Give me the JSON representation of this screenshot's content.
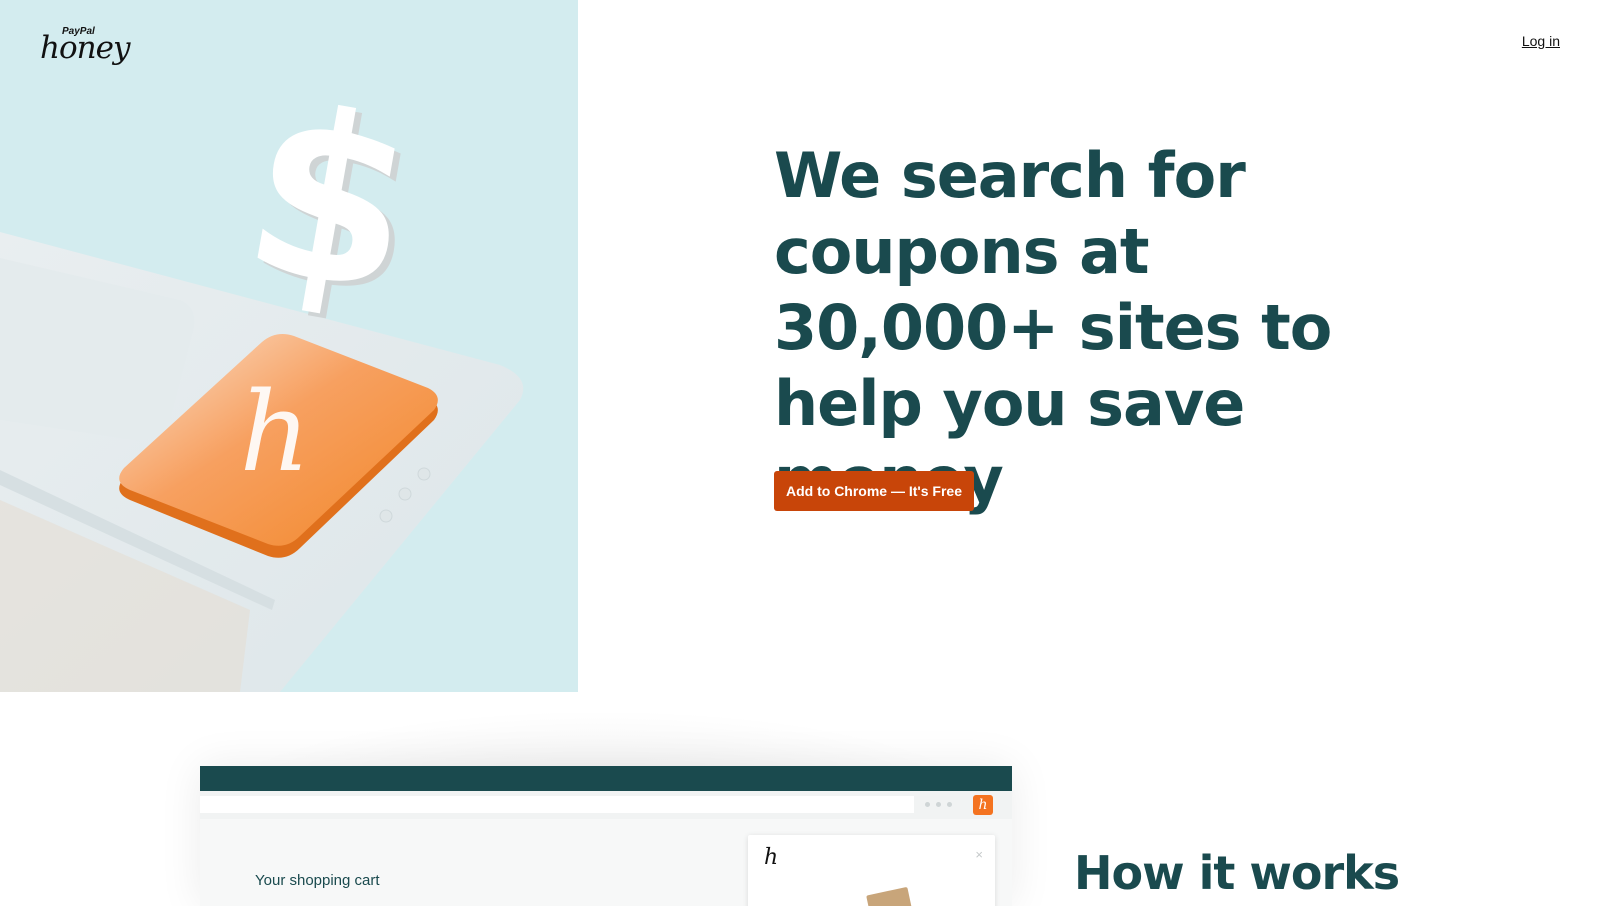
{
  "header": {
    "logo_brand_small": "PayPal",
    "logo_brand_main": "honey",
    "login_label": "Log in"
  },
  "hero": {
    "headline": "We search for coupons at 30,000+ sites to help you save money",
    "cta_label": "Add to Chrome — It's Free",
    "art_icons": [
      "dollar-sign-icon",
      "honey-h-key-icon"
    ]
  },
  "demo": {
    "cart_title": "Your shopping cart",
    "ext_icon_glyph": "h",
    "popup_logo_glyph": "h",
    "popup_close_glyph": "×"
  },
  "how_it_works": {
    "title": "How it works"
  },
  "colors": {
    "brand_teal": "#1a4a4e",
    "cta_orange": "#c84509",
    "honey_orange": "#f47320",
    "hero_bg": "#d3ecef"
  }
}
